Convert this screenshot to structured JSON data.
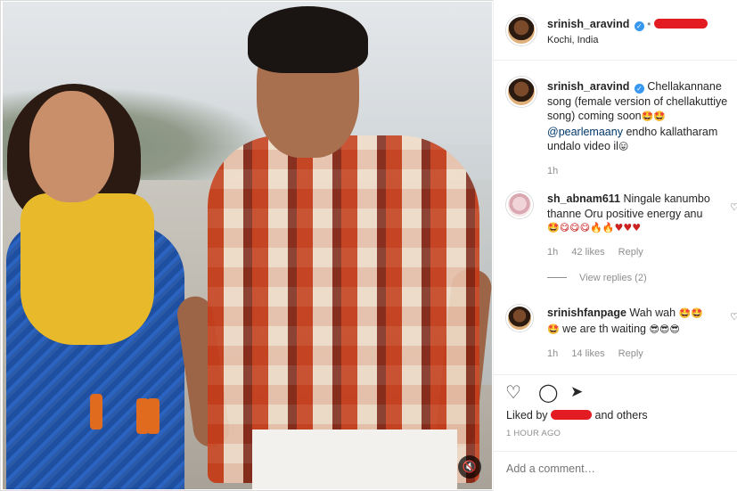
{
  "post": {
    "username": "srinish_aravind",
    "location": "Kochi, India",
    "follow_sep": "•",
    "sound_icon": "speaker-mute-icon"
  },
  "caption": {
    "username": "srinish_aravind",
    "line1": "Chellakannane",
    "line2": "song (female version of chellakuttiye",
    "line3": "song) coming soon",
    "line3_emoji": "🤩🤩",
    "mention": "@pearlemaany",
    "line4_rest": " endho kallatharam",
    "line5": "undalo video il",
    "line5_emoji": "😛",
    "time": "1h"
  },
  "comments": [
    {
      "username": "sh_abnam611",
      "text_line1": "Ningale kanumbo",
      "text_line2": "thanne Oru positive energy anu",
      "emoji_line": "🤩😋😋😋🔥🔥♥♥♥",
      "time": "1h",
      "likes": "42 likes",
      "reply": "Reply",
      "view_replies": "View replies (2)"
    },
    {
      "username": "srinishfanpage",
      "text_line1": "Wah wah ",
      "emoji1": "🤩🤩",
      "text_line2": " we are th waiting ",
      "emoji2": "😎😎😎",
      "time": "1h",
      "likes": "14 likes",
      "reply": "Reply"
    }
  ],
  "actions": {
    "like_icon": "heart-icon",
    "comment_icon": "comment-icon",
    "share_icon": "share-icon",
    "liked_by_prefix": "Liked by",
    "liked_by_suffix": "and others",
    "timestamp": "1 HOUR AGO"
  },
  "add_comment": {
    "placeholder": "Add a comment…"
  }
}
